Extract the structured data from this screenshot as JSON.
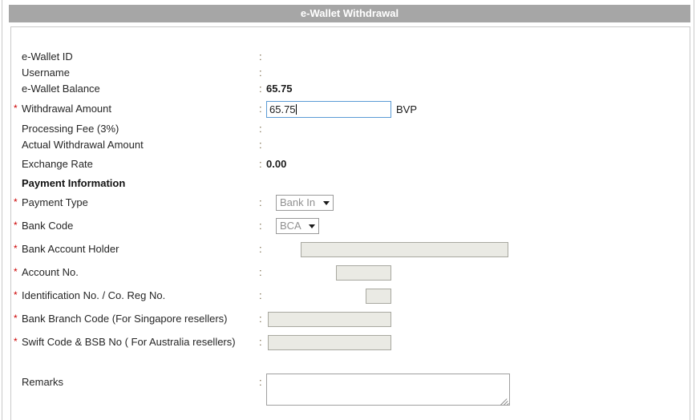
{
  "header": {
    "title": "e-Wallet Withdrawal"
  },
  "form": {
    "colon": ":",
    "required_mark": "*",
    "rows": {
      "ewallet_id": {
        "label": "e-Wallet ID",
        "value": ""
      },
      "username": {
        "label": "Username",
        "value": ""
      },
      "ewallet_balance": {
        "label": "e-Wallet Balance",
        "value": "65.75"
      },
      "withdrawal_amount": {
        "label": "Withdrawal Amount",
        "value": "65.75",
        "currency_suffix": "BVP"
      },
      "processing_fee": {
        "label": "Processing Fee (3%)",
        "value": ""
      },
      "actual_withdrawal_amount": {
        "label": "Actual Withdrawal Amount",
        "value": ""
      },
      "exchange_rate": {
        "label": "Exchange Rate",
        "value": "0.00"
      },
      "payment_information": {
        "label": "Payment Information"
      },
      "payment_type": {
        "label": "Payment Type",
        "value": "Bank In"
      },
      "bank_code": {
        "label": "Bank Code",
        "value": "BCA"
      },
      "bank_account_holder": {
        "label": "Bank Account Holder",
        "value": ""
      },
      "account_no": {
        "label": "Account No.",
        "value": ""
      },
      "identification_no": {
        "label": "Identification No. / Co. Reg No.",
        "value": ""
      },
      "bank_branch_code": {
        "label": "Bank Branch Code (For Singapore resellers)",
        "value": ""
      },
      "swift_code": {
        "label": "Swift Code & BSB No ( For Australia resellers)",
        "value": ""
      },
      "remarks": {
        "label": "Remarks",
        "value": ""
      }
    }
  },
  "colors": {
    "title_bar": "#a6a6a6",
    "required_asterisk": "#cc0000",
    "focus_border": "#5b9bd5",
    "disabled_field": "#eaeae4"
  }
}
